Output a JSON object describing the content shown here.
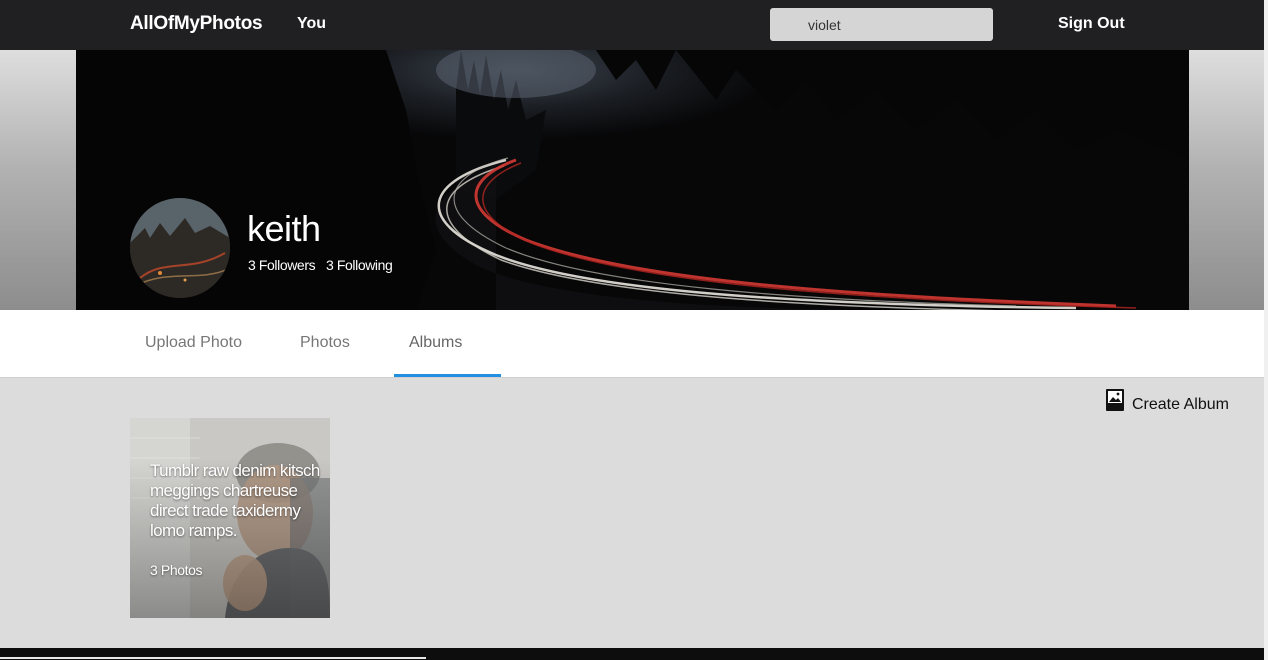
{
  "header": {
    "brand": "AllOfMyPhotos",
    "nav_you": "You",
    "search_value": "violet",
    "sign_out": "Sign Out"
  },
  "profile": {
    "username": "keith",
    "followers": "3 Followers",
    "following": "3 Following"
  },
  "tabs": [
    {
      "label": "Upload Photo"
    },
    {
      "label": "Photos"
    },
    {
      "label": "Albums",
      "active": true
    }
  ],
  "actions": {
    "create_album": "Create Album",
    "create_album_icon": "photo-album-icon"
  },
  "albums": [
    {
      "title": "Tumblr raw denim kitsch meggings chartreuse direct trade taxidermy lomo ramps.",
      "count": "3 Photos"
    }
  ],
  "colors": {
    "topbar": "#202022",
    "active_tab_underline": "#2190e0",
    "content_bg": "#dcdcdc"
  }
}
